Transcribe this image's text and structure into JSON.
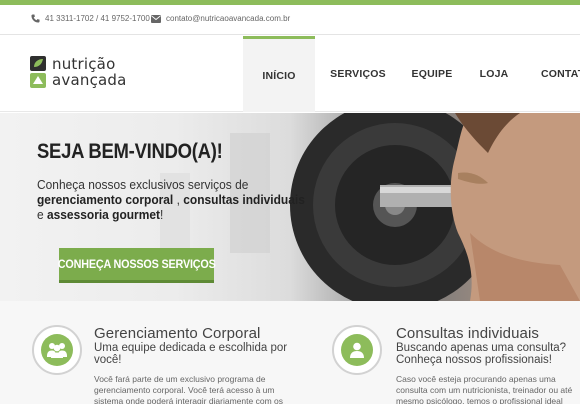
{
  "topbar": {
    "phone": "41 3311-1702 / 41 9752-1700",
    "email": "contato@nutricaoavancada.com.br"
  },
  "logo": {
    "line1": "nutrição",
    "line2": "avançada"
  },
  "nav": {
    "items": [
      "INÍCIO",
      "SERVIÇOS",
      "EQUIPE",
      "LOJA",
      "CONTATO"
    ],
    "active": "INÍCIO"
  },
  "hero": {
    "title": "SEJA BEM-VINDO(A)!",
    "line1": "Conheça nossos exclusivos serviços de",
    "line2_bold_a": "gerenciamento corporal",
    "line2_sep": " , ",
    "line2_bold_b": "consultas individuais",
    "line3_pre": "e ",
    "line3_bold": "assessoria gourmet",
    "line3_post": "!",
    "button": "CONHEÇA NOSSOS SERVIÇOS"
  },
  "services": [
    {
      "icon": "group-icon",
      "title": "Gerenciamento Corporal",
      "subtitle": "Uma equipe dedicada e escolhida por você!",
      "body": "Você fará parte de um exclusivo programa de gerenciamento corporal. Você terá acesso à um sistema onde poderá interagir diariamente com os"
    },
    {
      "icon": "person-icon",
      "title": "Consultas individuais",
      "subtitle": "Buscando apenas uma consulta? Conheça nossos profissionais!",
      "body": "Caso você esteja procurando apenas uma consulta com um nutricionista, treinador ou até mesmo psicólogo, temos o profissional ideal para te"
    }
  ],
  "colors": {
    "accent": "#8dbc5b",
    "button": "#7cac4c"
  }
}
